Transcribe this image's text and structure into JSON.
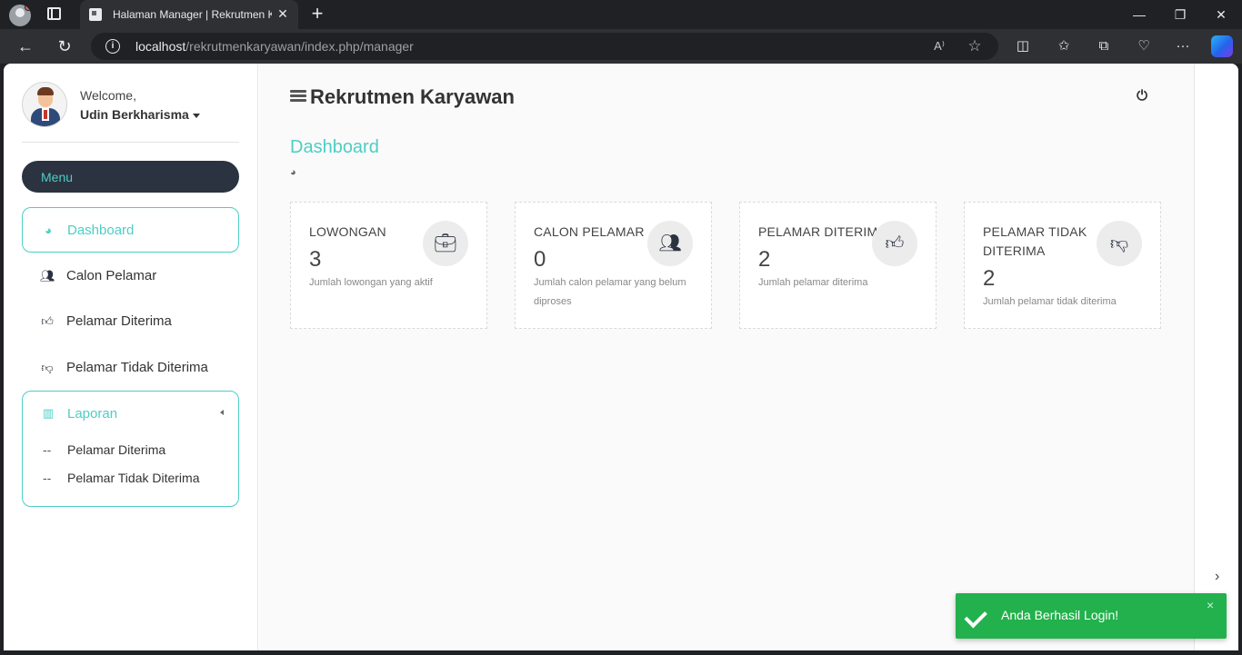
{
  "browser": {
    "tab_title": "Halaman Manager | Rekrutmen Karyawan",
    "tab_close": "✕",
    "new_tab": "+",
    "url_host": "localhost",
    "url_path": "/rekrutmenkaryawan/index.php/manager",
    "read_aloud_label": "A⁾",
    "window_controls": {
      "minimize": "—",
      "maximize": "❐",
      "close": "✕"
    }
  },
  "sidebar": {
    "welcome": "Welcome,",
    "username": "Udin Berkharisma",
    "menu_title": "Menu",
    "items": [
      {
        "label": "Dashboard",
        "icon": "dashboard-icon",
        "active": true
      },
      {
        "label": "Calon Pelamar",
        "icon": "users-icon",
        "active": false
      },
      {
        "label": "Pelamar Diterima",
        "icon": "thumbs-up-icon",
        "active": false
      },
      {
        "label": "Pelamar Tidak Diterima",
        "icon": "thumbs-down-icon",
        "active": false
      }
    ],
    "laporan": {
      "label": "Laporan",
      "icon": "bar-chart-icon",
      "sub_items": [
        {
          "prefix": "--",
          "label": "Pelamar Diterima"
        },
        {
          "prefix": "--",
          "label": "Pelamar Tidak Diterima"
        }
      ]
    }
  },
  "header": {
    "app_title": "Rekrutmen Karyawan"
  },
  "page": {
    "title": "Dashboard"
  },
  "cards": [
    {
      "label": "LOWONGAN",
      "value": "3",
      "desc": "Jumlah lowongan yang aktif",
      "icon": "briefcase-icon"
    },
    {
      "label": "CALON PELAMAR",
      "value": "0",
      "desc": "Jumlah calon pelamar yang belum diproses",
      "icon": "users-icon"
    },
    {
      "label": "PELAMAR DITERIMA",
      "value": "2",
      "desc": "Jumlah pelamar diterima",
      "icon": "thumbs-up-icon"
    },
    {
      "label": "PELAMAR TIDAK DITERIMA",
      "value": "2",
      "desc": "Jumlah pelamar tidak diterima",
      "icon": "thumbs-down-icon"
    }
  ],
  "toast": {
    "message": "Anda Berhasil Login!",
    "close": "×"
  },
  "colors": {
    "accent": "#4ecdc4",
    "dark": "#2b3340",
    "success": "#22b14c"
  }
}
